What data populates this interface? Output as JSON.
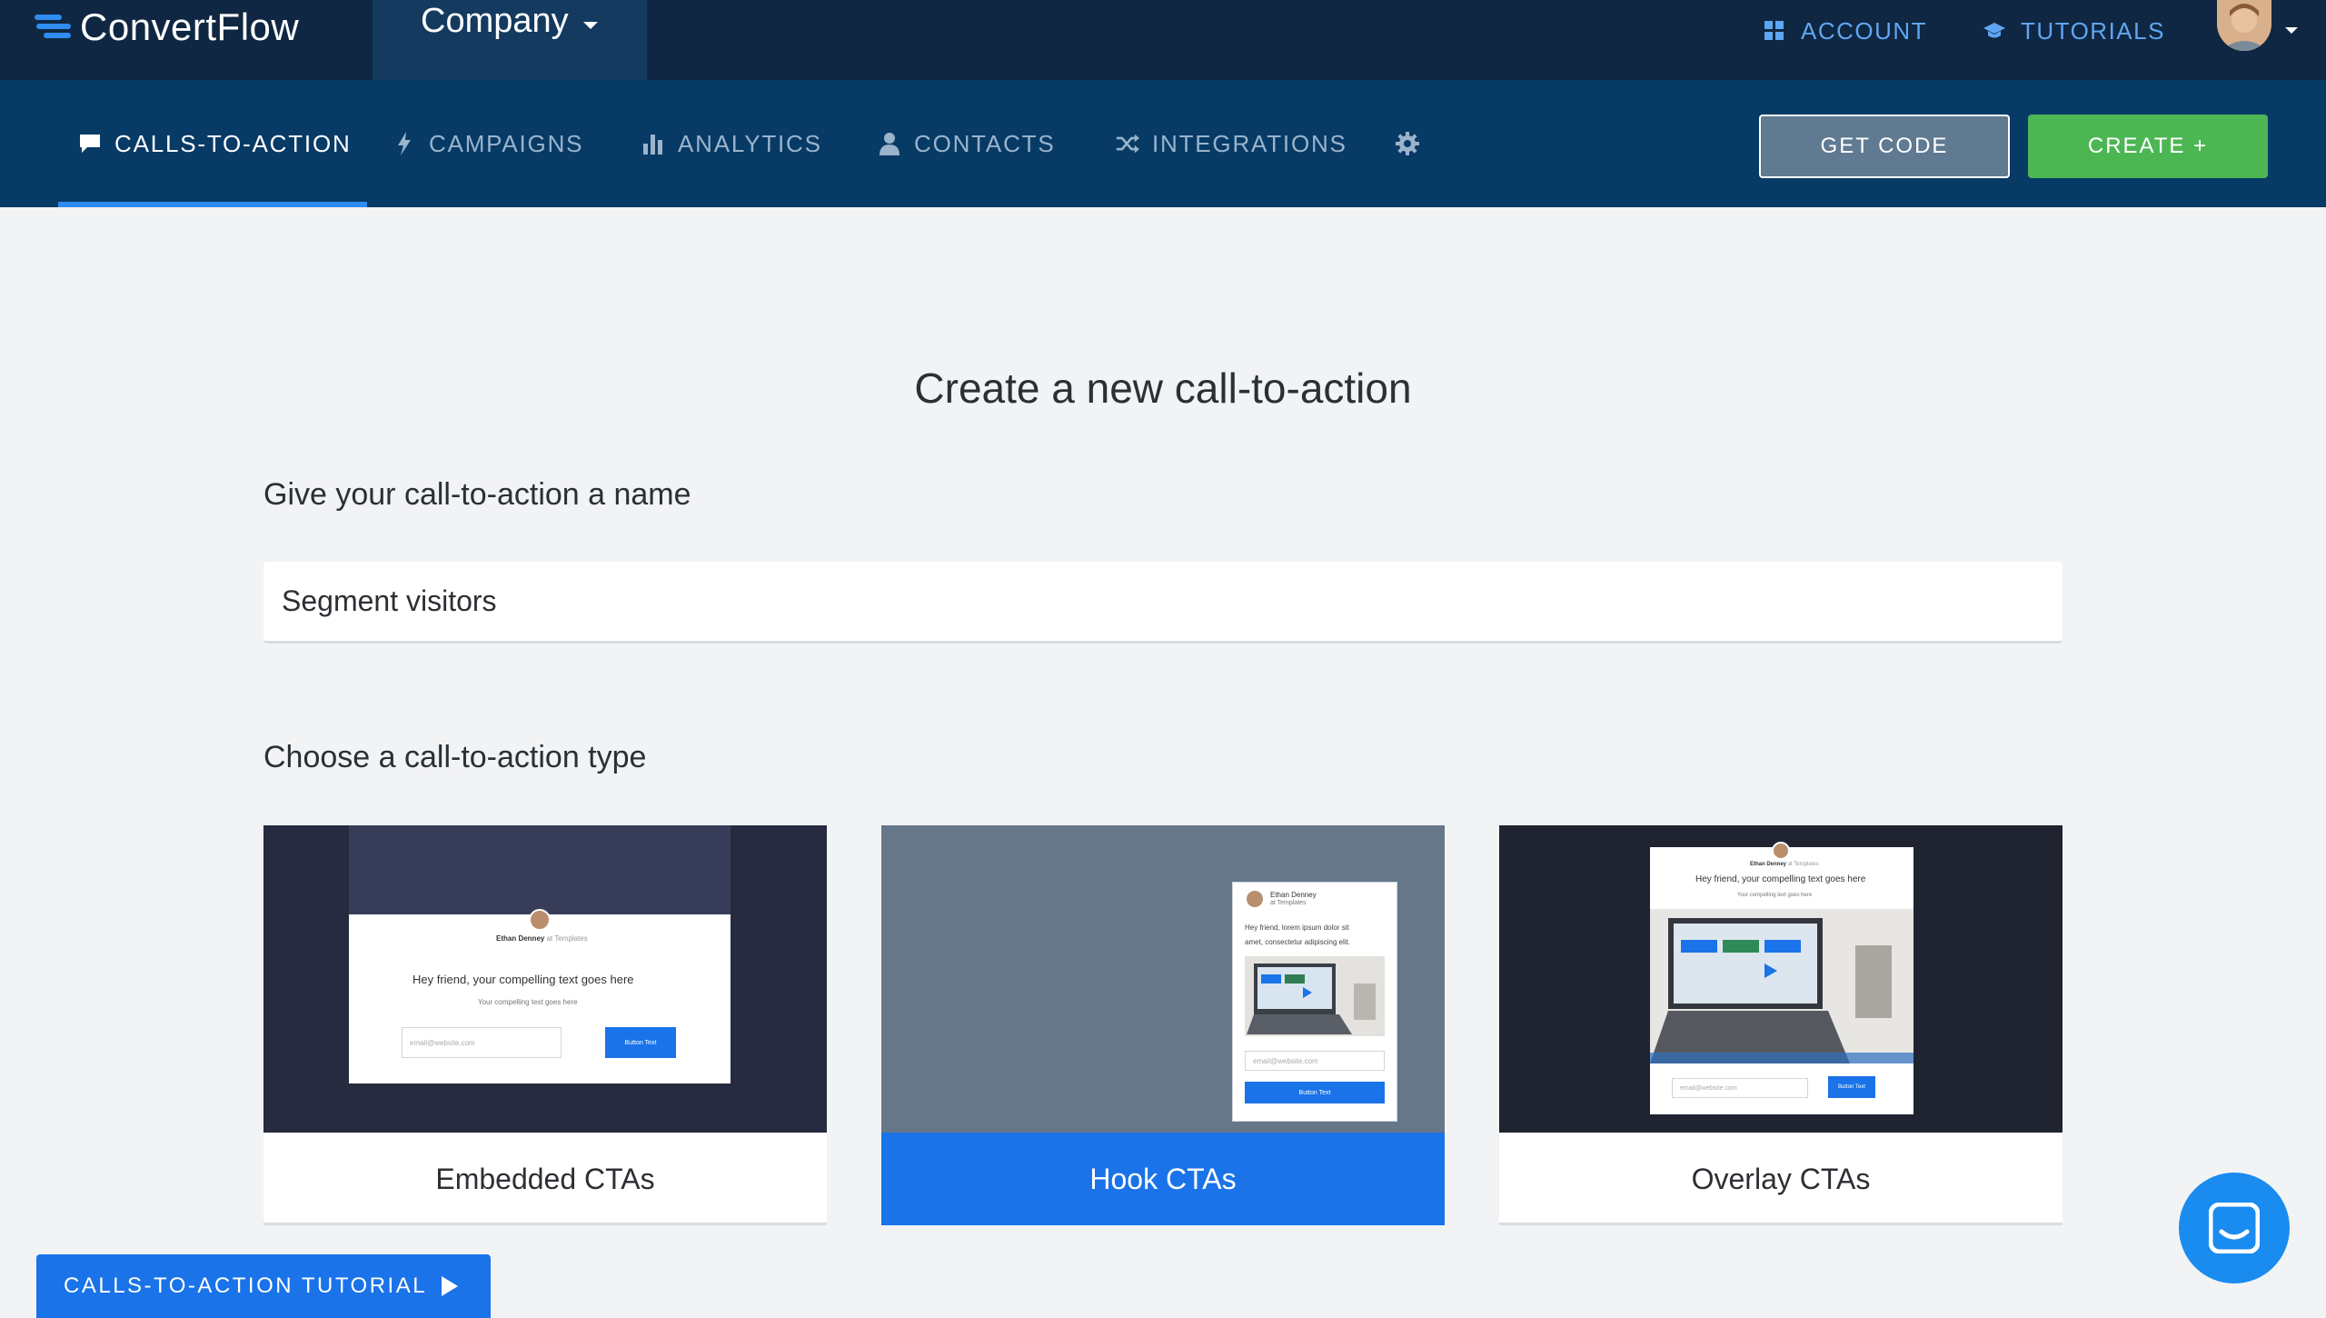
{
  "header": {
    "brand": "ConvertFlow",
    "workspace": "Company",
    "account_label": "ACCOUNT",
    "tutorials_label": "TUTORIALS"
  },
  "nav": {
    "items": [
      {
        "label": "CALLS-TO-ACTION",
        "icon": "chat-bubble-icon",
        "active": true
      },
      {
        "label": "CAMPAIGNS",
        "icon": "lightning-icon"
      },
      {
        "label": "ANALYTICS",
        "icon": "bar-chart-icon"
      },
      {
        "label": "CONTACTS",
        "icon": "person-icon"
      },
      {
        "label": "INTEGRATIONS",
        "icon": "shuffle-icon"
      }
    ],
    "settings_icon": "gear-icon",
    "get_code_label": "GET CODE",
    "create_label": "CREATE +"
  },
  "main": {
    "title": "Create a new call-to-action",
    "name_label": "Give your call-to-action a name",
    "name_value": "Segment visitors",
    "type_label": "Choose a call-to-action type",
    "cards": [
      {
        "label": "Embedded CTAs",
        "selected": false
      },
      {
        "label": "Hook CTAs",
        "selected": true
      },
      {
        "label": "Overlay CTAs",
        "selected": false
      }
    ]
  },
  "previews": {
    "author_name": "Ethan Denney",
    "author_suffix": "at Templates",
    "headline": "Hey friend, your compelling text goes here",
    "subtext": "Your compelling text goes here",
    "hook_text_1": "Hey friend, lorem ipsum dolor sit",
    "hook_text_2": "amet, consectetur adipiscing elit.",
    "email_placeholder": "email@website.com",
    "button_text": "Button Text"
  },
  "footer": {
    "tutorial_label": "CALLS-TO-ACTION TUTORIAL"
  },
  "colors": {
    "topbar": "#0f2742",
    "navbar": "#083a66",
    "accent_blue": "#1a73e8",
    "create_green": "#4cb653",
    "get_code_gray": "#5f7a91",
    "nav_link_blue": "#5fa6f2"
  }
}
